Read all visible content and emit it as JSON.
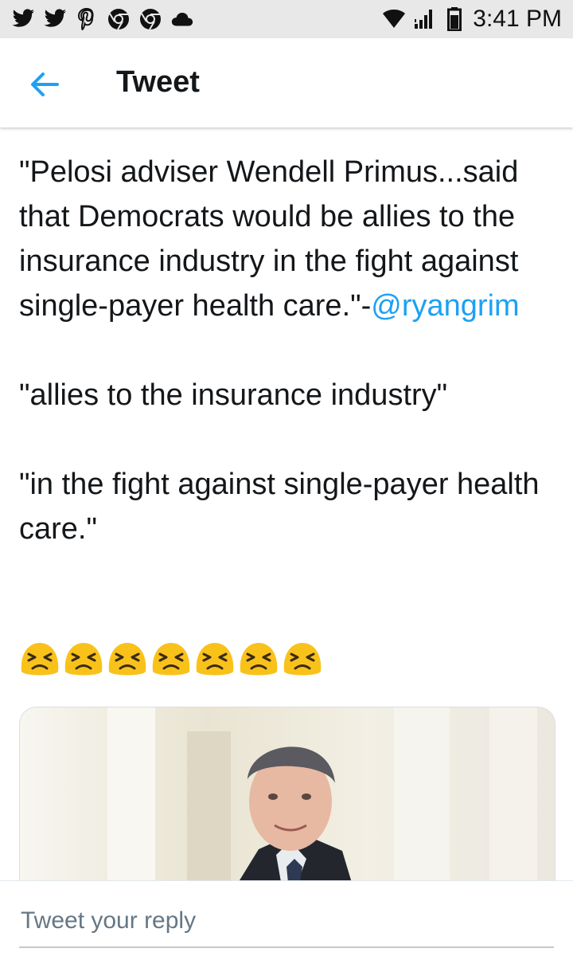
{
  "status_bar": {
    "time": "3:41 PM",
    "notification_icons": [
      "twitter-icon",
      "twitter-icon",
      "pinterest-icon",
      "chrome-icon",
      "chrome-icon",
      "cloud-icon"
    ],
    "system_icons": [
      "wifi-icon",
      "signal-icon",
      "battery-icon"
    ]
  },
  "header": {
    "title": "Tweet",
    "accent_color": "#1da1f2"
  },
  "tweet": {
    "paragraph1": "\"Pelosi adviser Wendell Primus...said that Democrats would be allies to the insurance industry in the fight against single-payer health care.\"-",
    "mention": "@ryangrim",
    "paragraph2": "\"allies to the insurance industry\"",
    "paragraph3": "\"in the fight against single-payer health care.\"",
    "emoji": [
      "persevering-face",
      "persevering-face",
      "persevering-face",
      "persevering-face",
      "persevering-face",
      "persevering-face",
      "persevering-face"
    ]
  },
  "reply": {
    "placeholder": "Tweet your reply"
  }
}
